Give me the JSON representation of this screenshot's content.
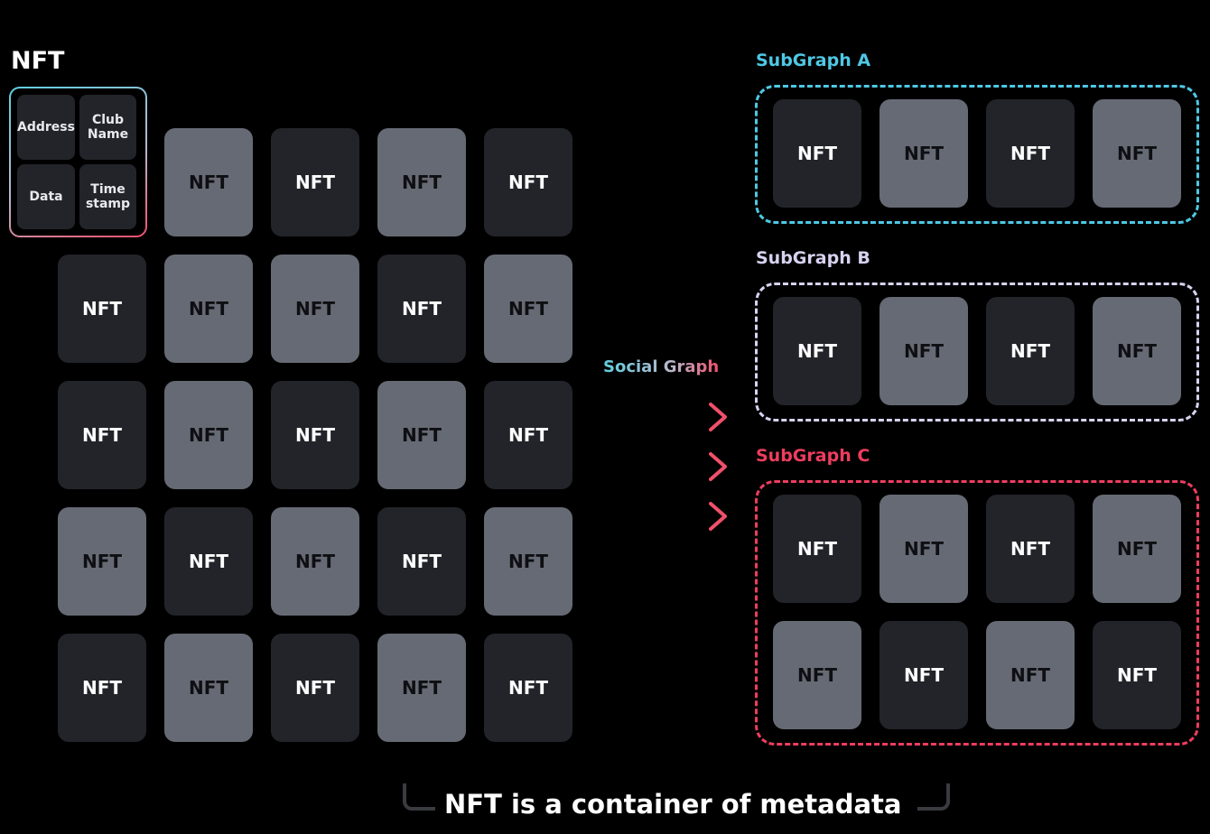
{
  "title": "NFT",
  "metadata_fields": [
    "Address",
    "Club Name",
    "Data",
    "Time stamp"
  ],
  "tile_label": "NFT",
  "grid": {
    "rows": [
      [
        "empty",
        "light",
        "dark",
        "light",
        "dark"
      ],
      [
        "dark",
        "light",
        "light",
        "dark",
        "light"
      ],
      [
        "dark",
        "light",
        "dark",
        "light",
        "dark"
      ],
      [
        "light",
        "dark",
        "light",
        "dark",
        "light"
      ],
      [
        "dark",
        "light",
        "dark",
        "light",
        "dark"
      ]
    ]
  },
  "social_graph_label": "Social Graph",
  "subgraphs": [
    {
      "label": "SubGraph A",
      "color": "#4fc8e4",
      "rows": [
        [
          "dark",
          "light",
          "dark",
          "light"
        ]
      ]
    },
    {
      "label": "SubGraph B",
      "color": "#d8d2f0",
      "rows": [
        [
          "dark",
          "light",
          "dark",
          "light"
        ]
      ]
    },
    {
      "label": "SubGraph C",
      "color": "#ee3d5f",
      "rows": [
        [
          "dark",
          "light",
          "dark",
          "light"
        ],
        [
          "light",
          "dark",
          "light",
          "dark"
        ]
      ]
    }
  ],
  "colors": {
    "accent_cyan": "#5fcfe0",
    "accent_pink": "#f0506a",
    "tile_dark": "#222429",
    "tile_light": "#666a74"
  },
  "caption": "NFT is a container of metadata"
}
